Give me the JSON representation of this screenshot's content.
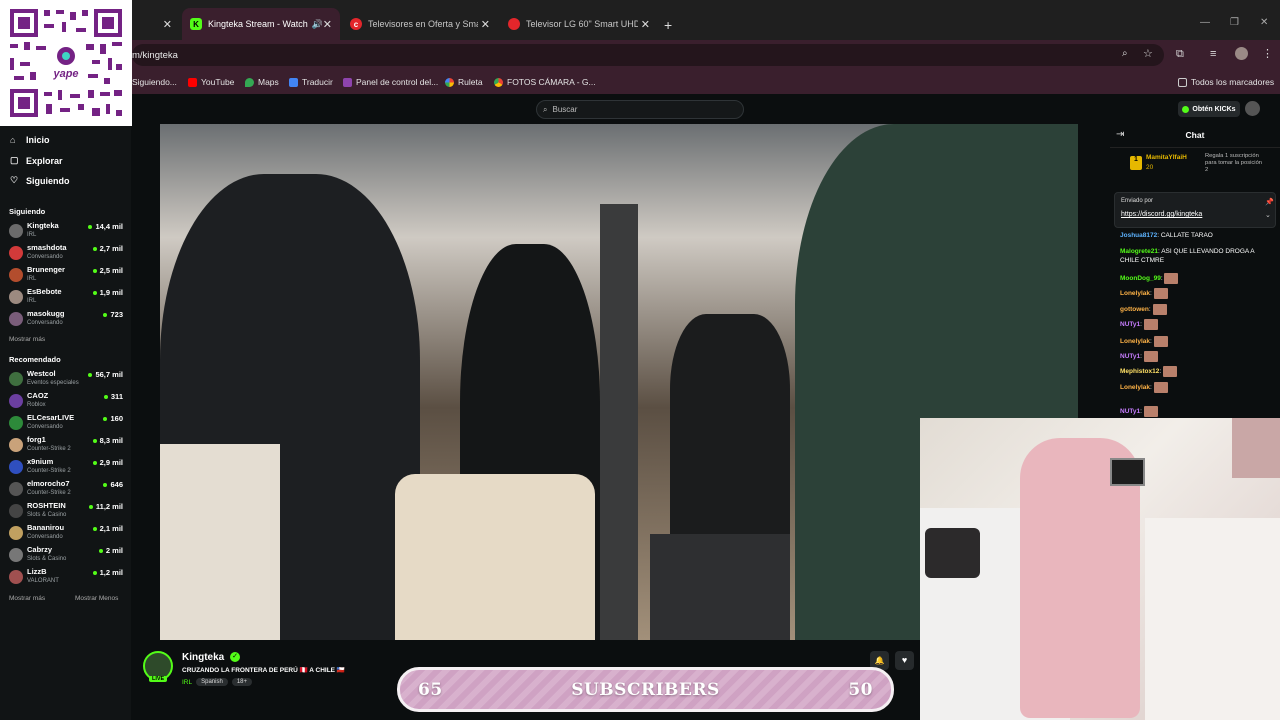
{
  "browser": {
    "tabs": [
      {
        "label": "Kingteka Stream - Watch L…",
        "active": true
      },
      {
        "label": "Televisores en Oferta y Smart T…",
        "active": false
      },
      {
        "label": "Televisor LG 60\" Smart UHD 4K…",
        "active": false
      }
    ],
    "url": "m/kingteka",
    "bookmarks": [
      "Siguiendo...",
      "YouTube",
      "Maps",
      "Traducir",
      "Panel de control del...",
      "Ruleta",
      "FOTOS CÁMARA - G..."
    ],
    "all_bookmarks": "Todos los marcadores"
  },
  "header": {
    "search_placeholder": "Buscar",
    "get_kicks": "Obtén KICKs"
  },
  "sidebar": {
    "nav": [
      "Inicio",
      "Explorar",
      "Siguiendo"
    ],
    "following_title": "Siguiendo",
    "following": [
      {
        "name": "Kingteka",
        "category": "IRL",
        "viewers": "14,4 mil"
      },
      {
        "name": "smashdota",
        "category": "Conversando",
        "viewers": "2,7 mil"
      },
      {
        "name": "Brunenger",
        "category": "IRL",
        "viewers": "2,5 mil"
      },
      {
        "name": "EsBebote",
        "category": "IRL",
        "viewers": "1,9 mil"
      },
      {
        "name": "masokugg",
        "category": "Conversando",
        "viewers": "723"
      }
    ],
    "show_more_1": "Mostrar más",
    "recommended_title": "Recomendado",
    "recommended": [
      {
        "name": "Westcol",
        "category": "Eventos especiales",
        "viewers": "56,7 mil"
      },
      {
        "name": "CAOZ",
        "category": "Roblox",
        "viewers": "311"
      },
      {
        "name": "ELCesarLIVE",
        "category": "Conversando",
        "viewers": "160"
      },
      {
        "name": "forg1",
        "category": "Counter-Strike 2",
        "viewers": "8,3 mil"
      },
      {
        "name": "x9nium",
        "category": "Counter-Strike 2",
        "viewers": "2,9 mil"
      },
      {
        "name": "elmorocho7",
        "category": "Counter-Strike 2",
        "viewers": "646"
      },
      {
        "name": "ROSHTEIN",
        "category": "Slots & Casino",
        "viewers": "11,2 mil"
      },
      {
        "name": "Bananirou",
        "category": "Conversando",
        "viewers": "2,1 mil"
      },
      {
        "name": "Cabrzy",
        "category": "Slots & Casino",
        "viewers": "2 mil"
      },
      {
        "name": "LizzB",
        "category": "VALORANT",
        "viewers": "1,2 mil"
      }
    ],
    "show_more_2": "Mostrar más",
    "show_less": "Mostrar Menos"
  },
  "chat": {
    "title": "Chat",
    "top_gifter": {
      "name": "MamitaYIfaiH",
      "count": "20",
      "note": "Regala 1 suscripción para tomar la posición 2"
    },
    "pinned_by": "Enviado por",
    "pinned_link": "https://discord.gg/kingteka",
    "messages": [
      {
        "user": "Joshua8172",
        "color": "#5db3ff",
        "text": "CALLATE TARAO"
      },
      {
        "user": "Malogrete21",
        "color": "#53fc18",
        "text": "ASI QUE LLEVANDO DROGA A CHILE CTMRE"
      },
      {
        "user": "MoonDog_99",
        "color": "#53fc18",
        "text": ""
      },
      {
        "user": "Lonelylak",
        "color": "#ffb347",
        "text": ""
      },
      {
        "user": "gottowen",
        "color": "#ffb347",
        "text": ""
      },
      {
        "user": "NUTy1",
        "color": "#c77dff",
        "text": ""
      },
      {
        "user": "Lonelylak",
        "color": "#ffb347",
        "text": ""
      },
      {
        "user": "NUTy1",
        "color": "#c77dff",
        "text": ""
      },
      {
        "user": "Mephistox12",
        "color": "#ffe066",
        "text": ""
      },
      {
        "user": "Lonelylak",
        "color": "#ffb347",
        "text": ""
      },
      {
        "user": "NUTy1",
        "color": "#c77dff",
        "text": ""
      }
    ]
  },
  "stream": {
    "streamer": "Kingteka",
    "live": "LIVE",
    "title": "CRUZANDO LA FRONTERA DE PERÚ 🇵🇪 A CHILE 🇨🇱",
    "category": "IRL",
    "language": "Spanish",
    "age": "18+"
  },
  "overlay": {
    "left_num": "65",
    "label": "SUBSCRIBERS",
    "right_num": "50"
  },
  "qr_label": "yape",
  "colors": {
    "kick_green": "#53fc18",
    "browser_bar": "#3a1f2d"
  }
}
